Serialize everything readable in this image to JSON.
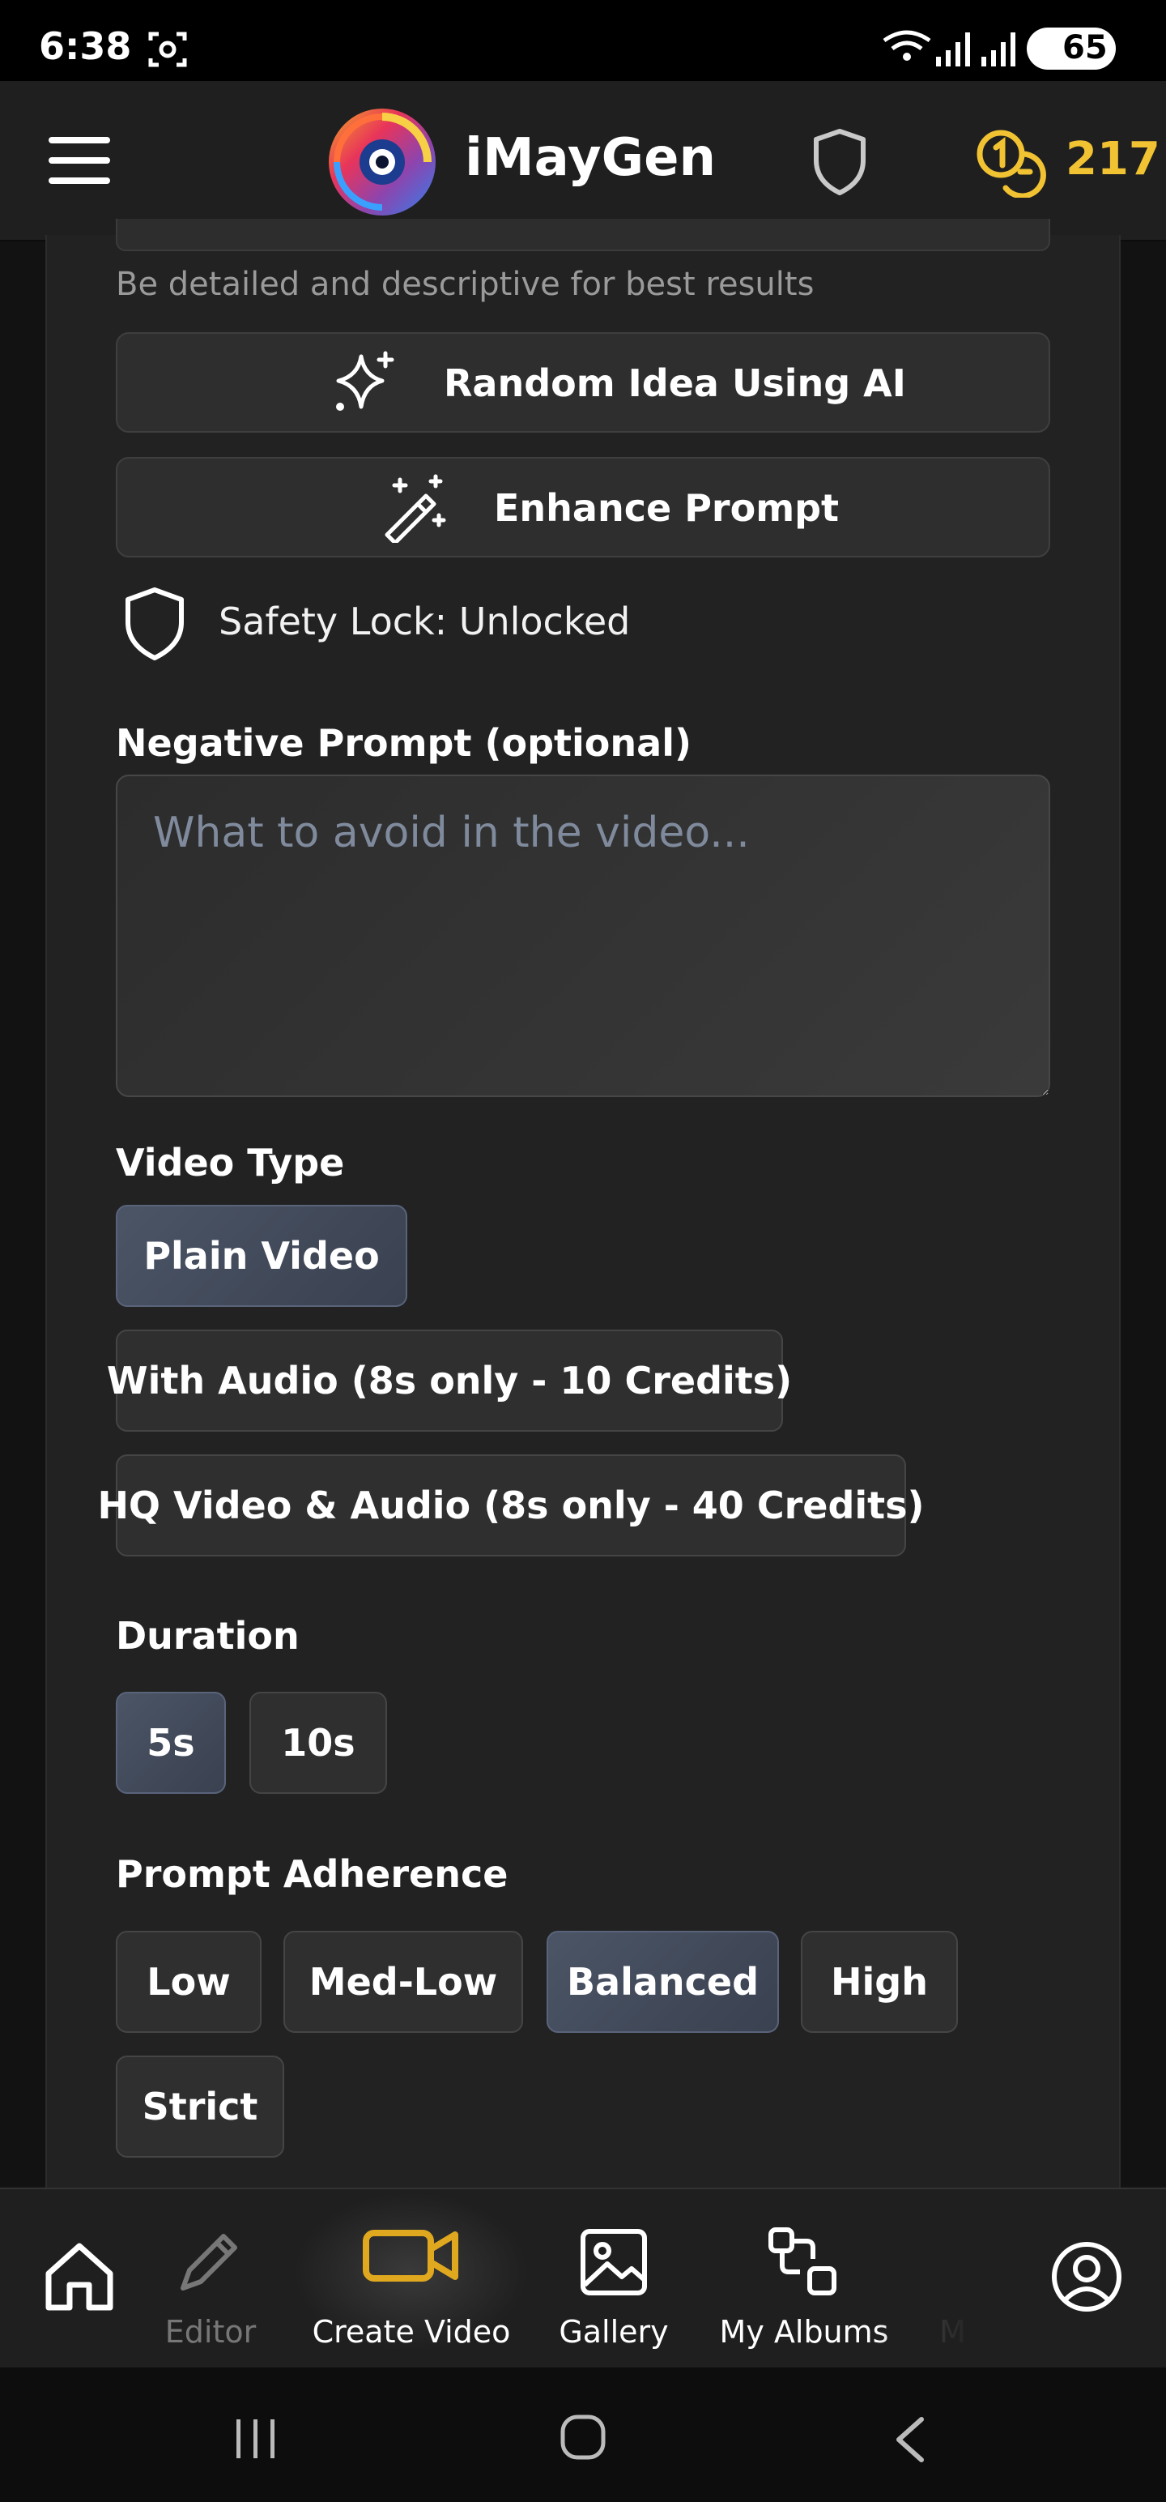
{
  "status_bar": {
    "time": "6:38",
    "battery": "65"
  },
  "header": {
    "app_title": "iMayGen",
    "credits": "217"
  },
  "prompt": {
    "hint": "Be detailed and descriptive for best results",
    "random_idea_label": "Random Idea Using AI",
    "enhance_label": "Enhance Prompt",
    "safety_lock": "Safety Lock: Unlocked"
  },
  "negative_prompt": {
    "label": "Negative Prompt (optional)",
    "placeholder": "What to avoid in the video...",
    "value": ""
  },
  "video_type": {
    "label": "Video Type",
    "options": [
      "Plain Video",
      "With Audio (8s only - 10 Credits)",
      "HQ Video & Audio (8s only - 40 Credits)"
    ],
    "selected": "Plain Video"
  },
  "duration": {
    "label": "Duration",
    "options": [
      "5s",
      "10s"
    ],
    "selected": "5s"
  },
  "prompt_adherence": {
    "label": "Prompt Adherence",
    "options": [
      "Low",
      "Med-Low",
      "Balanced",
      "High",
      "Strict"
    ],
    "selected": "Balanced"
  },
  "bottom_nav": {
    "items": [
      {
        "label": "",
        "icon": "home-icon"
      },
      {
        "label": "Editor",
        "icon": "pencil-icon"
      },
      {
        "label": "Create Video",
        "icon": "video-camera-icon"
      },
      {
        "label": "Gallery",
        "icon": "image-icon"
      },
      {
        "label": "My Albums",
        "icon": "albums-icon"
      },
      {
        "label": "M",
        "icon": ""
      },
      {
        "label": "",
        "icon": "profile-icon"
      }
    ],
    "active": "Create Video"
  },
  "colors": {
    "accent_gold": "#f1c232",
    "selected_option": "#4b5566",
    "background": "#222222"
  }
}
